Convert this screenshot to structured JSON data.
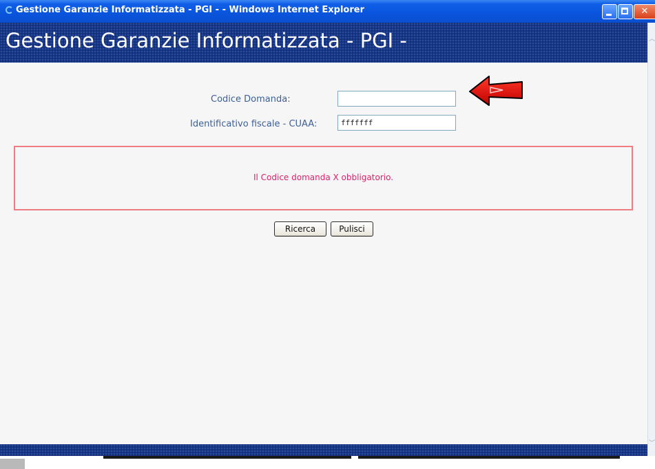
{
  "window": {
    "title": "Gestione Garanzie Informatizzata - PGI - - Windows Internet Explorer",
    "buttons": {
      "minimize": "minimize-icon",
      "maximize": "maximize-icon",
      "close": "close-icon"
    }
  },
  "header": {
    "title": "Gestione Garanzie Informatizzata - PGI -"
  },
  "form": {
    "codice_label": "Codice Domanda:",
    "codice_value": "",
    "cuaa_label": "Identificativo fiscale - CUAA:",
    "cuaa_value": "fffffff"
  },
  "error": {
    "message": "Il Codice domanda X obbligatorio."
  },
  "actions": {
    "search_label": "Ricerca",
    "clear_label": "Pulisci"
  },
  "colors": {
    "header_band": "#17378a",
    "label_text": "#3d5f95",
    "error_text": "#e0206a",
    "error_border": "#ef7c82",
    "annotation_arrow": "#e00000"
  }
}
